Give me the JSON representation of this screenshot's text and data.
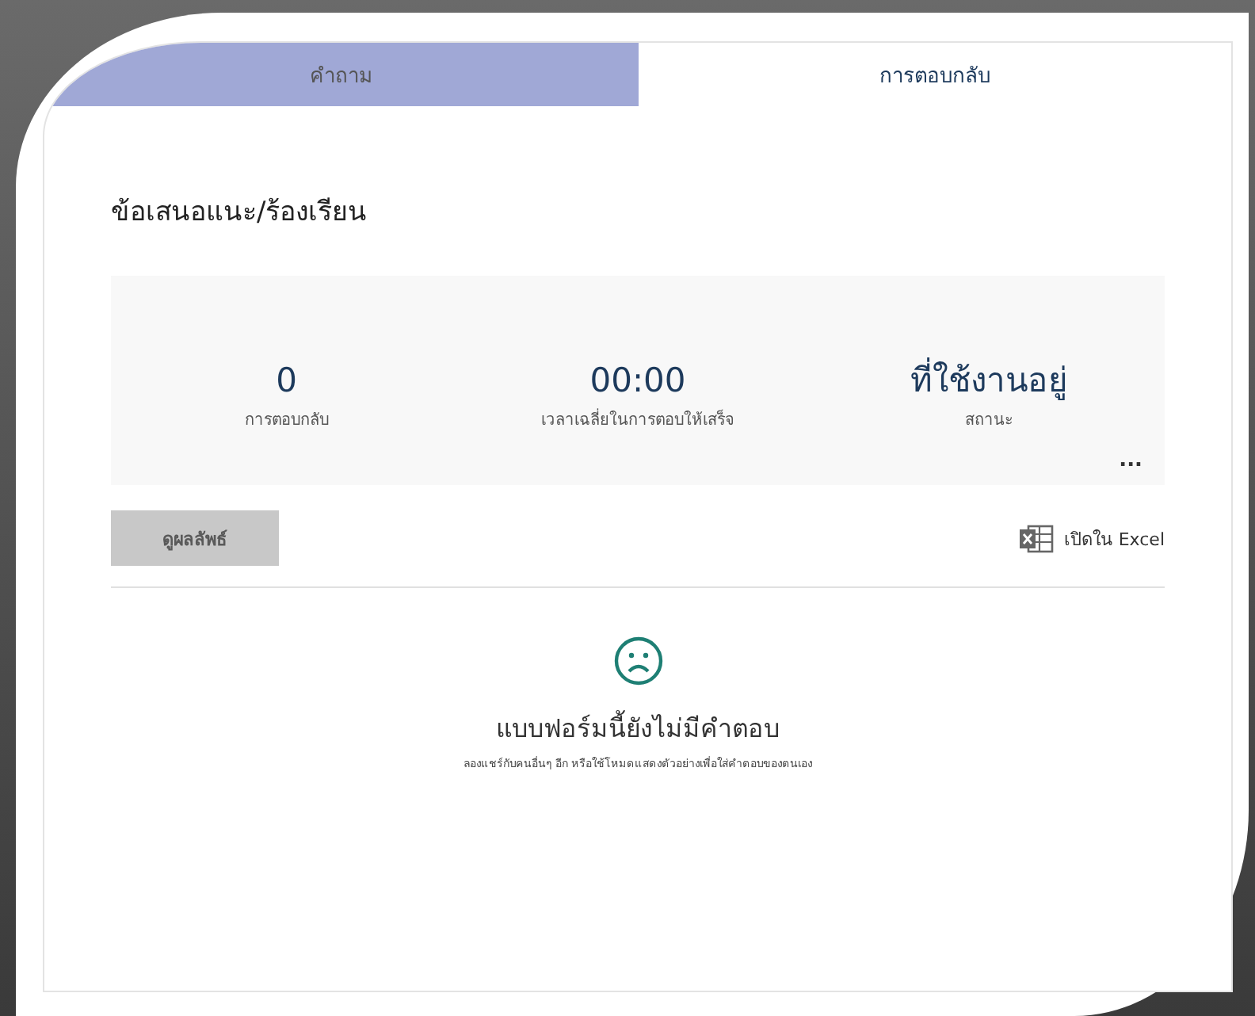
{
  "tabs": [
    {
      "label": "คำถาม",
      "selected": false
    },
    {
      "label": "การตอบกลับ",
      "selected": true
    }
  ],
  "form_title": "ข้อเสนอแนะ/ร้องเรียน",
  "stats": [
    {
      "value": "0",
      "label": "การตอบกลับ"
    },
    {
      "value": "00:00",
      "label": "เวลาเฉลี่ยในการตอบให้เสร็จ"
    },
    {
      "value": "ที่ใช้งานอยู่",
      "label": "สถานะ"
    }
  ],
  "more_menu": "...",
  "view_results_button": {
    "label": "ดูผลลัพธ์",
    "disabled": true
  },
  "open_in_excel": "เปิดใน Excel",
  "empty_state": {
    "title": "แบบฟอร์มนี้ยังไม่มีคำตอบ",
    "hint": "ลองแชร์กับคนอื่นๆ อีก หรือใช้โหมดแสดงตัวอย่างเพื่อใส่คำตอบของตนเอง"
  }
}
